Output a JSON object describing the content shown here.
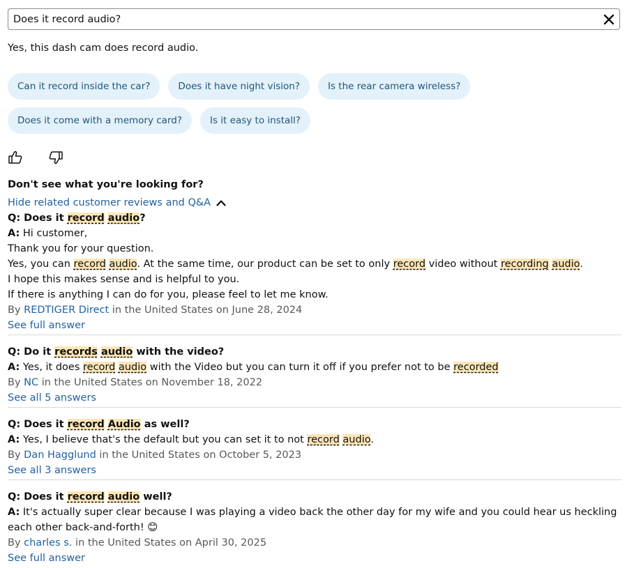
{
  "search": {
    "value": "Does it record audio?",
    "clear_icon": "close-icon"
  },
  "answer": "Yes, this dash cam does record audio.",
  "suggestions": [
    "Can it record inside the car?",
    "Does it have night vision?",
    "Is the rear camera wireless?",
    "Does it come with a memory card?",
    "Is it easy to install?"
  ],
  "feedback": {
    "up_icon": "thumbs-up-icon",
    "down_icon": "thumbs-down-icon"
  },
  "not_found": "Don't see what you're looking for?",
  "hide_link": {
    "label": "Hide related customer reviews and Q&A",
    "icon": "chevron-up-icon"
  },
  "qa": [
    {
      "question": [
        {
          "t": "Q: Does it "
        },
        {
          "t": "record",
          "hl": true
        },
        {
          "t": " "
        },
        {
          "t": "audio",
          "hl": true
        },
        {
          "t": "?"
        }
      ],
      "answer_lines": [
        [
          {
            "t": "A:",
            "b": true
          },
          {
            "t": " Hi customer,"
          }
        ],
        [
          {
            "t": "Thank you for your question."
          }
        ],
        [
          {
            "t": "Yes, you can "
          },
          {
            "t": "record",
            "hl": true
          },
          {
            "t": " "
          },
          {
            "t": "audio",
            "hl": true
          },
          {
            "t": ". At the same time, our product can be set to only "
          },
          {
            "t": "record",
            "hl": true
          },
          {
            "t": " video without "
          },
          {
            "t": "recording",
            "hl": true
          },
          {
            "t": " "
          },
          {
            "t": "audio",
            "hl": true
          },
          {
            "t": "."
          }
        ],
        [
          {
            "t": "I hope this makes sense and is helpful to you."
          }
        ],
        [
          {
            "t": "If there is anything I can do for you, please feel to let me know."
          }
        ]
      ],
      "by": "By ",
      "author": "REDTIGER Direct",
      "meta": " in the United States on June 28, 2024",
      "link": "See full answer"
    },
    {
      "question": [
        {
          "t": "Q: Do it "
        },
        {
          "t": "records",
          "hl": true
        },
        {
          "t": " "
        },
        {
          "t": "audio",
          "hl": true
        },
        {
          "t": " with the video?"
        }
      ],
      "answer_lines": [
        [
          {
            "t": "A:",
            "b": true
          },
          {
            "t": " Yes, it does "
          },
          {
            "t": "record",
            "hl": true
          },
          {
            "t": " "
          },
          {
            "t": "audio",
            "hl": true
          },
          {
            "t": " with the Video but you can turn it off if you prefer not to be "
          },
          {
            "t": "recorded",
            "hl": true
          }
        ]
      ],
      "by": "By ",
      "author": "NC",
      "meta": " in the United States on November 18, 2022",
      "link": "See all 5 answers"
    },
    {
      "question": [
        {
          "t": "Q: Does it "
        },
        {
          "t": "record",
          "hl": true
        },
        {
          "t": " "
        },
        {
          "t": "Audio",
          "hl": true
        },
        {
          "t": " as well?"
        }
      ],
      "answer_lines": [
        [
          {
            "t": "A:",
            "b": true
          },
          {
            "t": " Yes, I believe that's the default but you can set it to not "
          },
          {
            "t": "record",
            "hl": true
          },
          {
            "t": " "
          },
          {
            "t": "audio",
            "hl": true
          },
          {
            "t": "."
          }
        ]
      ],
      "by": "By ",
      "author": "Dan Hagglund",
      "meta": " in the United States on October 5, 2023",
      "link": "See all 3 answers"
    },
    {
      "question": [
        {
          "t": "Q: Does it "
        },
        {
          "t": "record",
          "hl": true
        },
        {
          "t": " "
        },
        {
          "t": "audio",
          "hl": true
        },
        {
          "t": " well?"
        }
      ],
      "answer_lines": [
        [
          {
            "t": "A:",
            "b": true
          },
          {
            "t": " It's actually super clear because I was playing a video back the other day for my wife and you could hear us heckling each other back-and-forth! 😊"
          }
        ]
      ],
      "by": "By ",
      "author": "charles s.",
      "meta": " in the United States on April 30, 2025",
      "link": "See full answer"
    }
  ]
}
